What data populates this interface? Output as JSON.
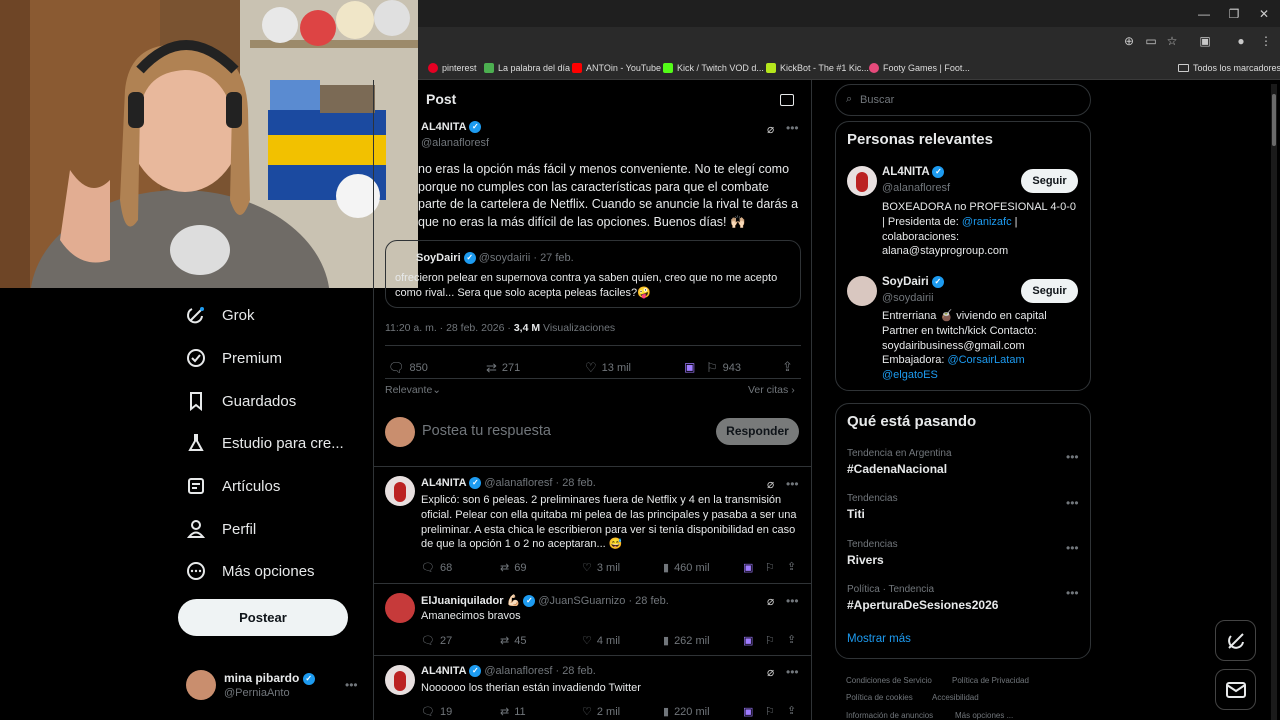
{
  "browser": {
    "bookmarks": [
      {
        "label": "pinterest",
        "color": "#e60023"
      },
      {
        "label": "La palabra del día",
        "color": "#4caf50"
      },
      {
        "label": "ANTOin - YouTube",
        "color": "#ff0000"
      },
      {
        "label": "Kick / Twitch VOD d...",
        "color": "#53fc18"
      },
      {
        "label": "KickBot - The #1 Kic...",
        "color": "#b5e61d"
      },
      {
        "label": "Footy Games | Foot...",
        "color": "#e64a7b"
      }
    ],
    "all_bookmarks": "Todos los marcadores"
  },
  "sidebar": {
    "items": [
      {
        "label": "Grok",
        "icon": "grok-icon"
      },
      {
        "label": "Premium",
        "icon": "premium-badge-icon"
      },
      {
        "label": "Guardados",
        "icon": "bookmark-icon"
      },
      {
        "label": "Estudio para cre...",
        "icon": "flask-icon"
      },
      {
        "label": "Artículos",
        "icon": "article-icon"
      },
      {
        "label": "Perfil",
        "icon": "person-icon"
      },
      {
        "label": "Más opciones",
        "icon": "more-circle-icon"
      }
    ],
    "post_button": "Postear",
    "account": {
      "name": "mina pibardo",
      "handle": "@PerniaAnto"
    }
  },
  "main": {
    "header_title": "Post",
    "post": {
      "author": "AL4NITA",
      "handle": "@alanafloresf",
      "text": "no eras la opción más fácil y menos conveniente. No te elegí como porque no cumples con las características para que el combate parte de la cartelera de Netflix. Cuando se anuncie la rival te darás a que no eras la más difícil de las opciones. Buenos días! 🙌🏻",
      "quote": {
        "author": "SoyDairi",
        "handle": "@soydairii",
        "date": "· 27 feb.",
        "text": "ofrecieron pelear en supernova contra ya saben quien, creo que no me acepto como rival... Sera que solo acepta peleas faciles?🤪"
      },
      "timestamp": "11:20 a. m. · 28 feb. 2026 ·",
      "views_count": "3,4 M",
      "views_label": "Visualizaciones",
      "stats": {
        "replies": "850",
        "reposts": "271",
        "likes": "13 mil",
        "bookmarks": "943"
      },
      "sort_label": "Relevante",
      "quotes_link": "Ver citas"
    },
    "reply_box": {
      "placeholder": "Postea tu respuesta",
      "button": "Responder"
    },
    "replies": [
      {
        "author": "AL4NITA",
        "handle": "@alanafloresf",
        "date": "· 28 feb.",
        "text": "Explicó: son 6 peleas. 2 preliminares fuera de Netflix y 4 en la transmisión oficial. Pelear con ella quitaba mi pelea de las principales y pasaba a ser una preliminar. A esta chica le escribieron para ver si tenía disponibilidad en caso de que la opción 1 o 2 no aceptaran... 😅",
        "replies": "68",
        "reposts": "69",
        "likes": "3 mil",
        "views": "460 mil"
      },
      {
        "author": "ElJuaniquilador 💪🏻",
        "handle": "@JuanSGuarnizo",
        "date": "· 28 feb.",
        "text": "Amanecimos bravos",
        "replies": "27",
        "reposts": "45",
        "likes": "4 mil",
        "views": "262 mil"
      },
      {
        "author": "AL4NITA",
        "handle": "@alanafloresf",
        "date": "· 28 feb.",
        "text": "Noooooo los therian están invadiendo Twitter",
        "replies": "19",
        "reposts": "11",
        "likes": "2 mil",
        "views": "220 mil"
      }
    ]
  },
  "right": {
    "search_placeholder": "Buscar",
    "relevant": {
      "title": "Personas relevantes",
      "people": [
        {
          "name": "AL4NITA",
          "handle": "@alanafloresf",
          "follow": "Seguir",
          "bio1": "BOXEADORA no PROFESIONAL 4-0-0",
          "bio2a": "| Presidenta de: ",
          "bio2link": "@ranizafc",
          "bio2b": " |",
          "bio3": "colaboraciones:",
          "bio4": "alana@stayprogroup.com"
        },
        {
          "name": "SoyDairi",
          "handle": "@soydairii",
          "follow": "Seguir",
          "bio1": "Entrerriana 🧉 viviendo en capital",
          "bio2": "Partner en twitch/kick Contacto:",
          "bio3": "soydairibusiness@gmail.com",
          "bio4a": "Embajadora: ",
          "bio4link": "@CorsairLatam",
          "bio5link": "@elgatoES"
        }
      ]
    },
    "trends": {
      "title": "Qué está pasando",
      "items": [
        {
          "meta": "Tendencia en Argentina",
          "name": "#CadenaNacional"
        },
        {
          "meta": "Tendencias",
          "name": "Titi"
        },
        {
          "meta": "Tendencias",
          "name": "Rivers"
        },
        {
          "meta": "Política · Tendencia",
          "name": "#AperturaDeSesiones2026"
        }
      ],
      "show_more": "Mostrar más"
    },
    "footer": [
      "Condiciones de Servicio",
      "Política de Privacidad",
      "Política de cookies",
      "Accesibilidad",
      "Información de anuncios",
      "Más opciones ..."
    ]
  },
  "colors": {
    "accent": "#1d9bf0",
    "background": "#000000",
    "border": "#2f3336",
    "muted": "#71767b"
  }
}
